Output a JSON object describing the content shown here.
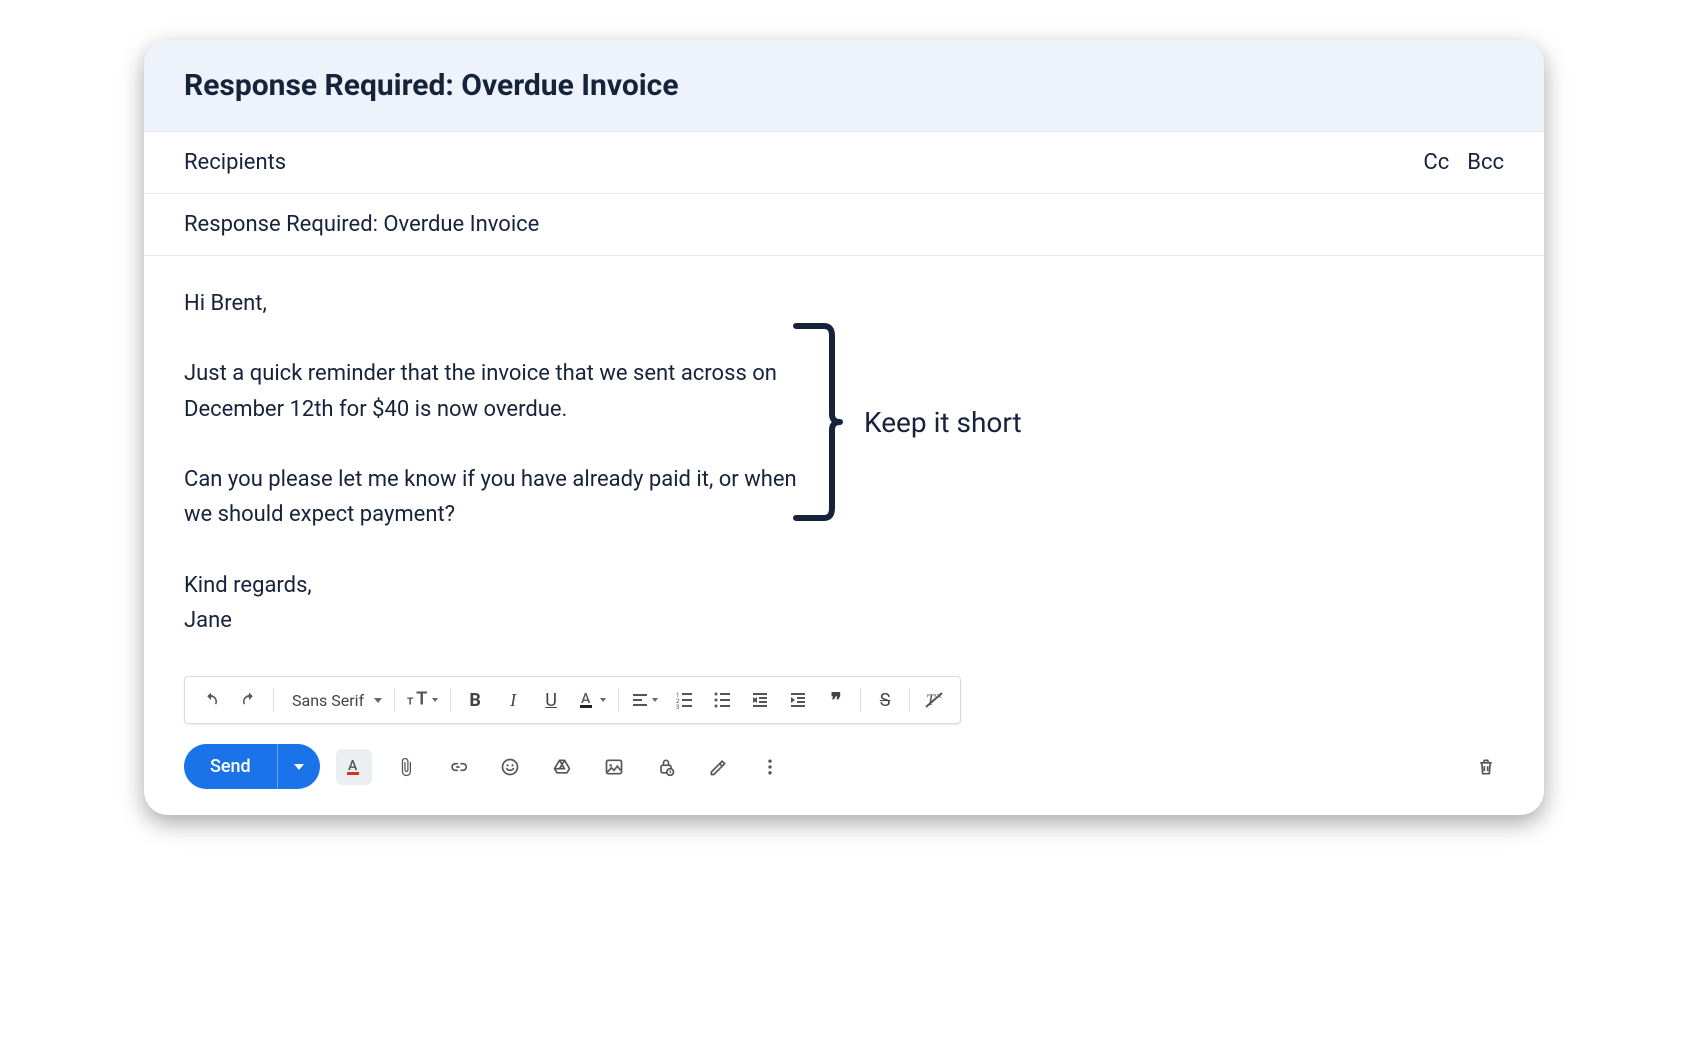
{
  "header": {
    "title": "Response Required: Overdue Invoice"
  },
  "recipients": {
    "label": "Recipients",
    "cc": "Cc",
    "bcc": "Bcc"
  },
  "subject": {
    "value": "Response Required: Overdue Invoice"
  },
  "body": {
    "text": "Hi Brent,\n\nJust a quick reminder that the invoice that we sent across on December 12th for $40 is now overdue.\n\nCan you please let me know if you have already paid it, or when we should expect payment?\n\nKind regards,\nJane"
  },
  "annotation": {
    "label": "Keep it short"
  },
  "format_toolbar": {
    "font": "Sans Serif"
  },
  "actions": {
    "send": "Send"
  },
  "icons": {
    "undo": "undo-icon",
    "redo": "redo-icon",
    "text_size": "text-size-icon",
    "bold": "bold-icon",
    "italic": "italic-icon",
    "underline": "underline-icon",
    "text_color": "text-color-icon",
    "align": "align-icon",
    "numbered_list": "numbered-list-icon",
    "bulleted_list": "bulleted-list-icon",
    "indent_less": "indent-less-icon",
    "indent_more": "indent-more-icon",
    "quote": "quote-icon",
    "strikethrough": "strikethrough-icon",
    "clear_format": "clear-format-icon",
    "text_color_action": "text-color-icon",
    "attach": "attach-icon",
    "link": "link-icon",
    "emoji": "emoji-icon",
    "drive": "drive-icon",
    "image": "image-icon",
    "confidential": "confidential-icon",
    "signature": "signature-icon",
    "more": "more-icon",
    "delete": "delete-icon"
  }
}
